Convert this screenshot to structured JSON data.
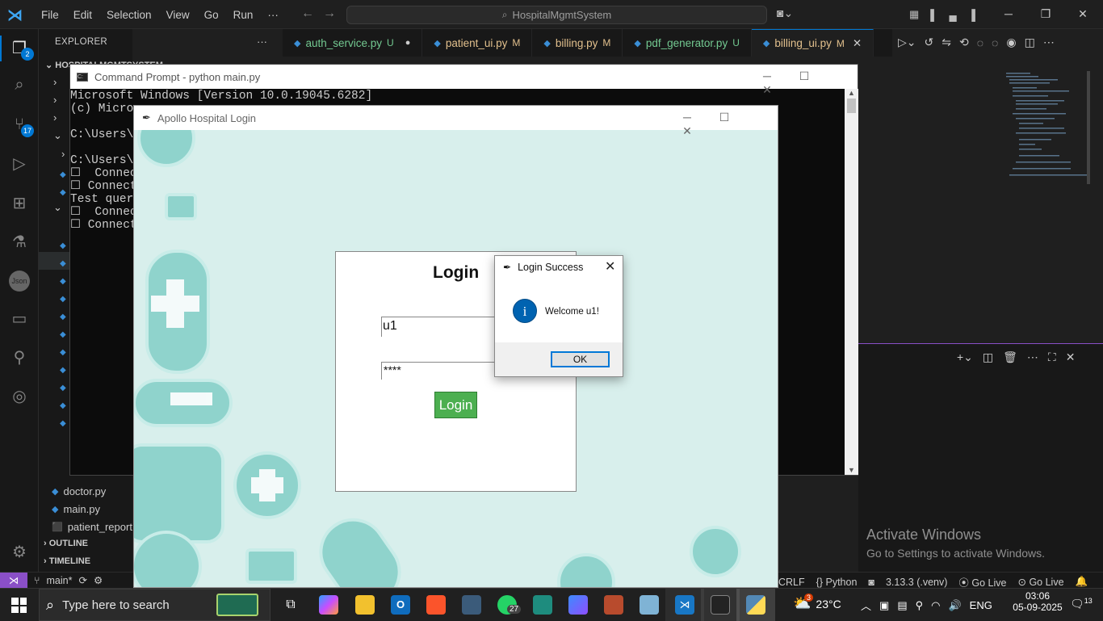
{
  "vscode": {
    "menu": [
      "File",
      "Edit",
      "Selection",
      "View",
      "Go",
      "Run",
      "···"
    ],
    "command_center": "HospitalMgmtSystem",
    "explorer_title": "EXPLORER",
    "explorer_more": "···",
    "project_root": "HOSPITALMGMTSYSTEM",
    "badges": {
      "explorer": "2",
      "scm": "17"
    },
    "json_icon_label": "Json",
    "files": [
      "doctor.py",
      "main.py",
      "patient_report"
    ],
    "outline": "OUTLINE",
    "timeline": "TIMELINE",
    "tabs": [
      {
        "label": "auth_service.py",
        "status": "U",
        "dirty": "●"
      },
      {
        "label": "patient_ui.py",
        "status": "M"
      },
      {
        "label": "billing.py",
        "status": "M"
      },
      {
        "label": "pdf_generator.py",
        "status": "U"
      },
      {
        "label": "billing_ui.py",
        "status": "M",
        "close": "✕"
      }
    ],
    "activate_title": "Activate Windows",
    "activate_sub": "Go to Settings to activate Windows.",
    "status": {
      "branch": "main*",
      "eol": "CRLF",
      "language": "{} Python",
      "interpreter": "3.13.3 (.venv)",
      "golive1": "Go Live",
      "golive2": "Go Live"
    }
  },
  "cmd": {
    "title": "Command Prompt - python  main.py",
    "lines": [
      "Microsoft Windows [Version 10.0.19045.6282]",
      "(c) Micros",
      "",
      "C:\\Users\\a",
      "",
      "C:\\Users\\a",
      "☐  Connect",
      "☐ Connecte",
      "Test query",
      "☐  Connect",
      "☐ Connecte"
    ]
  },
  "login_window": {
    "title": "Apollo Hospital Login",
    "heading": "Login",
    "username_value": "u1",
    "password_value": "****",
    "login_button": "Login",
    "button_color": "#4caf50"
  },
  "dialog": {
    "title": "Login Success",
    "message": "Welcome u1!",
    "ok": "OK",
    "info_glyph": "i"
  },
  "taskbar": {
    "search_placeholder": "Type here to search",
    "whatsapp_badge": "27",
    "temperature": "23°C",
    "language": "ENG",
    "time": "03:06",
    "date": "05-09-2025",
    "notifications": "13",
    "weather_badge": "3"
  },
  "colors": {
    "accent": "#0078d4",
    "git_modified": "#e2c08d",
    "untracked": "#73c991"
  }
}
